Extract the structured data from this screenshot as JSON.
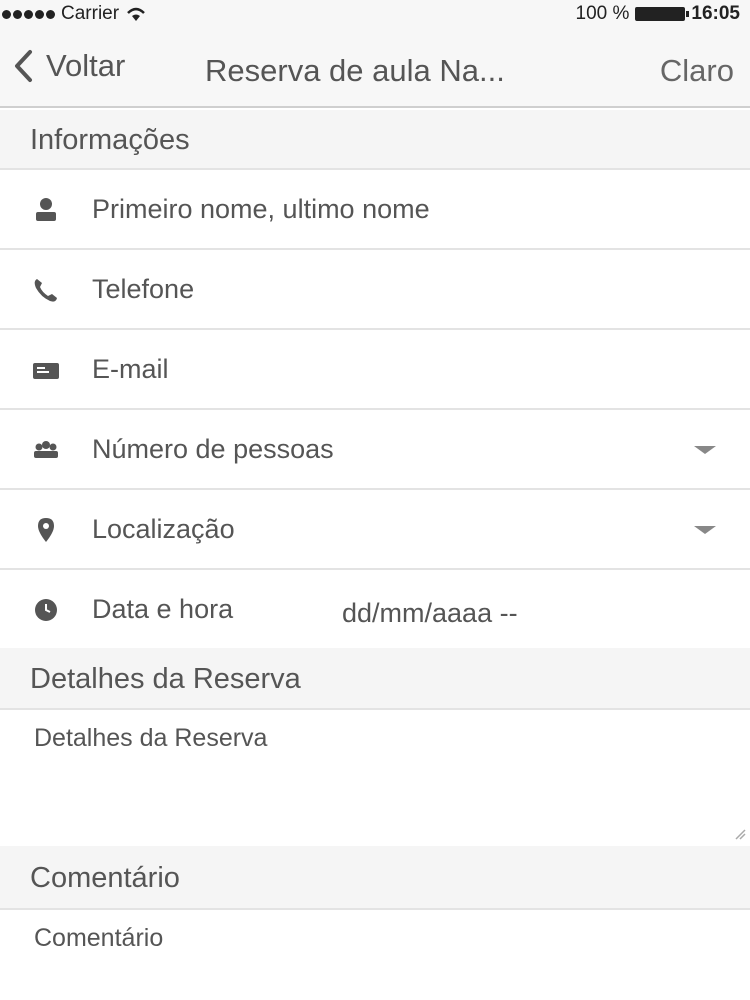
{
  "status_bar": {
    "carrier": "Carrier",
    "battery_percent": "100 %",
    "time": "16:05"
  },
  "navbar": {
    "back_label": "Voltar",
    "title": "Reserva de aula Na...",
    "right_label": "Claro"
  },
  "sections": {
    "info": "Informações",
    "details": "Detalhes da Reserva",
    "comment": "Comentário"
  },
  "fields": {
    "name": {
      "placeholder": "Primeiro nome, ultimo nome",
      "icon": "person-icon"
    },
    "phone": {
      "placeholder": "Telefone",
      "icon": "phone-icon"
    },
    "email": {
      "placeholder": "E-mail",
      "icon": "email-icon"
    },
    "people": {
      "placeholder": "Número de pessoas",
      "icon": "group-icon"
    },
    "location": {
      "placeholder": "Localização",
      "icon": "location-pin-icon"
    },
    "datetime": {
      "label": "Data e hora",
      "value": "dd/mm/aaaa  --",
      "icon": "clock-icon"
    }
  },
  "textareas": {
    "details_placeholder": "Detalhes da Reserva",
    "comment_placeholder": "Comentário"
  },
  "colors": {
    "text": "#555555",
    "header_bg": "#f5f5f5",
    "divider": "#e3e3e3"
  }
}
